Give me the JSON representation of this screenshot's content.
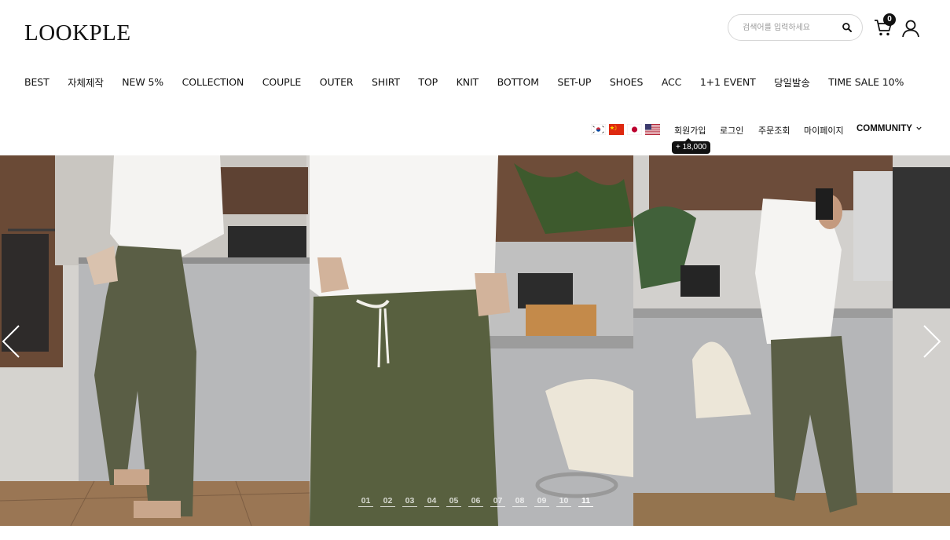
{
  "brand": {
    "logo": "LOOKPLE"
  },
  "search": {
    "placeholder": "검색어를 입력하세요"
  },
  "cart": {
    "count": "0"
  },
  "nav": {
    "items": [
      "BEST",
      "자체제작",
      "NEW 5%",
      "COLLECTION",
      "COUPLE",
      "OUTER",
      "SHIRT",
      "TOP",
      "KNIT",
      "BOTTOM",
      "SET-UP",
      "SHOES",
      "ACC",
      "1+1 EVENT",
      "당일발송",
      "TIME SALE 10%"
    ]
  },
  "utility": {
    "flags": [
      "korea-flag-icon",
      "china-flag-icon",
      "japan-flag-icon",
      "usa-flag-icon"
    ],
    "join": "회원가입",
    "login": "로그인",
    "order_lookup": "주문조회",
    "mypage": "마이페이지",
    "community": "COMMUNITY",
    "join_points": "+ 18,000"
  },
  "hero": {
    "pages": [
      "01",
      "02",
      "03",
      "04",
      "05",
      "06",
      "07",
      "08",
      "09",
      "10",
      "11"
    ],
    "active_page": "11",
    "prev_icon": "chevron-left-icon",
    "next_icon": "chevron-right-icon"
  },
  "colors": {
    "text": "#111111",
    "badge": "#111111",
    "pants": "#5a5e45"
  }
}
